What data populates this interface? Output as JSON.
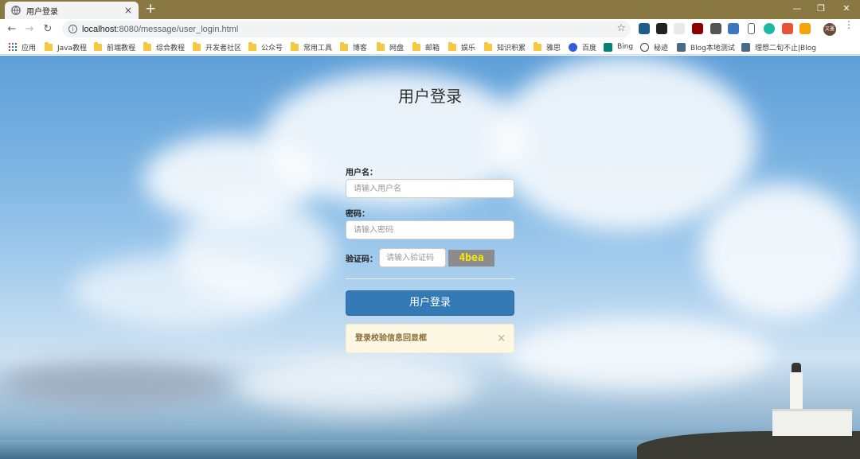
{
  "browser": {
    "tab": {
      "title": "用户登录",
      "close": "×"
    },
    "new_tab": "+",
    "window_controls": {
      "minimize": "—",
      "restore": "❐",
      "close": "✕"
    },
    "nav": {
      "back": "←",
      "forward": "→",
      "reload": "↻"
    },
    "address": {
      "info": "i",
      "host": "localhost",
      "path": ":8080/message/user_login.html",
      "star": "☆"
    },
    "avatar_text": "文墨",
    "menu": "⋮",
    "bookmarks": [
      {
        "label": "应用",
        "icon": "apps-grid-icon"
      },
      {
        "label": "Java教程",
        "icon": "folder-icon"
      },
      {
        "label": "前端教程",
        "icon": "folder-icon"
      },
      {
        "label": "综合教程",
        "icon": "folder-icon"
      },
      {
        "label": "开发者社区",
        "icon": "folder-icon"
      },
      {
        "label": "公众号",
        "icon": "folder-icon"
      },
      {
        "label": "常用工具",
        "icon": "folder-icon"
      },
      {
        "label": "博客",
        "icon": "folder-icon"
      },
      {
        "label": "网盘",
        "icon": "folder-icon"
      },
      {
        "label": "邮箱",
        "icon": "folder-icon"
      },
      {
        "label": "娱乐",
        "icon": "folder-icon"
      },
      {
        "label": "知识积累",
        "icon": "folder-icon"
      },
      {
        "label": "雅思",
        "icon": "folder-icon"
      },
      {
        "label": "百度",
        "icon": "baidu-icon"
      },
      {
        "label": "Bing",
        "icon": "bing-icon"
      },
      {
        "label": "秘迹",
        "icon": "mijisou-icon"
      },
      {
        "label": "Blog本地测试",
        "icon": "site-icon"
      },
      {
        "label": "理想二旬不止|Blog",
        "icon": "site-icon"
      }
    ]
  },
  "login": {
    "title": "用户登录",
    "username_label": "用户名：",
    "username_placeholder": "请输入用户名",
    "password_label": "密码：",
    "password_placeholder": "请输入密码",
    "captcha_label": "验证码：",
    "captcha_placeholder": "请输入验证码",
    "captcha_text": "4bea",
    "submit_label": "用户登录",
    "alert_text": "登录校验信息回显框",
    "alert_close": "×"
  }
}
